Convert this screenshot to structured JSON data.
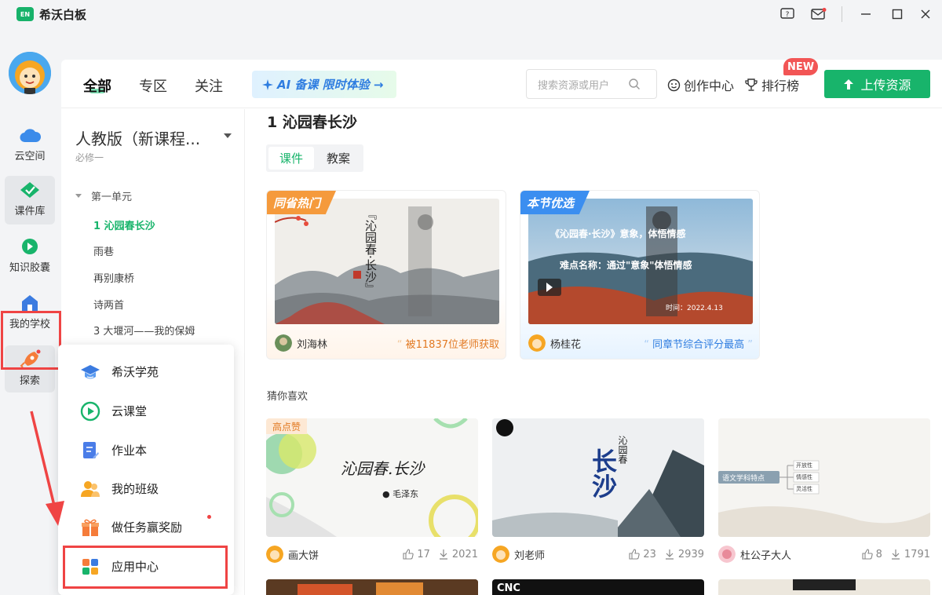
{
  "app": {
    "logo_text": "EN",
    "title": "希沃白板"
  },
  "sidebar": {
    "items": [
      {
        "label": "云空间"
      },
      {
        "label": "课件库"
      },
      {
        "label": "知识胶囊"
      },
      {
        "label": "我的学校"
      },
      {
        "label": "探索"
      }
    ]
  },
  "topnav": {
    "tabs": [
      "全部",
      "专区",
      "关注"
    ],
    "ai_banner": "AI 备课 限时体验 →",
    "search_placeholder": "搜索资源或用户",
    "create_label": "创作中心",
    "rank_label": "排行榜",
    "new_badge": "NEW",
    "upload_label": "上传资源"
  },
  "tree": {
    "book_title": "人教版（新课程...",
    "book_sub": "必修一",
    "unit": "第一单元",
    "lessons": [
      "1 沁园春长沙",
      "雨巷",
      "再别康桥",
      "诗两首",
      "3 大堰河——我的保姆"
    ]
  },
  "content": {
    "title": "1 沁园春长沙",
    "segments": [
      "课件",
      "教案"
    ],
    "featured": [
      {
        "tag": "同省热门",
        "author": "刘海林",
        "note": "被11837位老师获取",
        "img_title": "『沁园春·长沙』"
      },
      {
        "tag": "本节优选",
        "author": "杨桂花",
        "note": "同章节综合评分最高",
        "img_line1": "《沁园春·长沙》意象，体悟情感",
        "img_line2": "难点名称：通过\"意象\"体悟情感",
        "img_date": "时间：2022.4.13"
      }
    ],
    "section_label": "猜你喜欢",
    "cards": [
      {
        "badge": "高点赞",
        "img_title": "沁园春.长沙",
        "img_sub": "● 毛泽东",
        "author": "画大饼",
        "likes": "17",
        "downloads": "2021"
      },
      {
        "img_title": "长沙",
        "img_side": "沁园春",
        "author": "刘老师",
        "likes": "23",
        "downloads": "2939"
      },
      {
        "img_title": "语文学科特点",
        "img_branches": [
          "开放性",
          "情感性",
          "灵活性"
        ],
        "author": "杜公子大人",
        "likes": "8",
        "downloads": "1791"
      }
    ],
    "bottom_card_texts": [
      "CNC"
    ]
  },
  "popup": {
    "items": [
      "希沃学苑",
      "云课堂",
      "作业本",
      "我的班级",
      "做任务赢奖励",
      "应用中心"
    ]
  },
  "colors": {
    "accent": "#18b46b",
    "highlight": "#ef4444"
  }
}
